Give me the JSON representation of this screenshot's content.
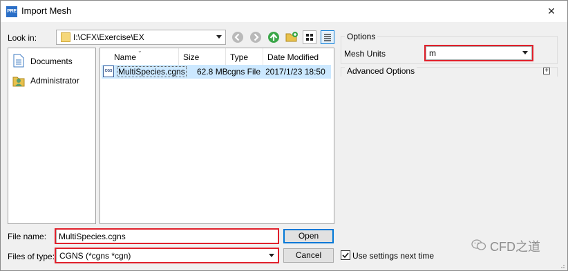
{
  "window": {
    "title": "Import Mesh",
    "app_icon_text": "PRE",
    "close_glyph": "✕"
  },
  "lookin": {
    "label": "Look in:",
    "path": "I:\\CFX\\Exercise\\EX"
  },
  "toolbar": {
    "back": "back-icon",
    "forward": "forward-icon",
    "up": "up-icon",
    "new_folder": "new-folder-icon",
    "list_view": "list-view-icon",
    "detail_view": "detail-view-icon"
  },
  "sidebar": {
    "items": [
      {
        "label": "Documents",
        "icon": "documents-icon"
      },
      {
        "label": "Administrator",
        "icon": "user-folder-icon"
      }
    ]
  },
  "files": {
    "columns": [
      "Name",
      "Size",
      "Type",
      "Date Modified"
    ],
    "rows": [
      {
        "name": "MultiSpecies.cgns",
        "size": "62.8 MB",
        "type": "cgns File",
        "date": "2017/1/23 18:50",
        "icon_text": "CGS"
      }
    ]
  },
  "filename": {
    "label": "File name:",
    "value": "MultiSpecies.cgns"
  },
  "filetype": {
    "label": "Files of type:",
    "value": "CGNS (*cgns *cgn)"
  },
  "buttons": {
    "open": "Open",
    "cancel": "Cancel"
  },
  "options": {
    "group_label": "Options",
    "mesh_units_label": "Mesh Units",
    "mesh_units_value": "m",
    "advanced_label": "Advanced Options",
    "expand_glyph": "+"
  },
  "settings": {
    "checkbox_label": "Use settings next time",
    "checked": true
  },
  "watermark": {
    "text": "CFD之道"
  },
  "colors": {
    "highlight_red": "#e0202b",
    "selection": "#cce8ff",
    "accent_blue": "#0078d7"
  }
}
